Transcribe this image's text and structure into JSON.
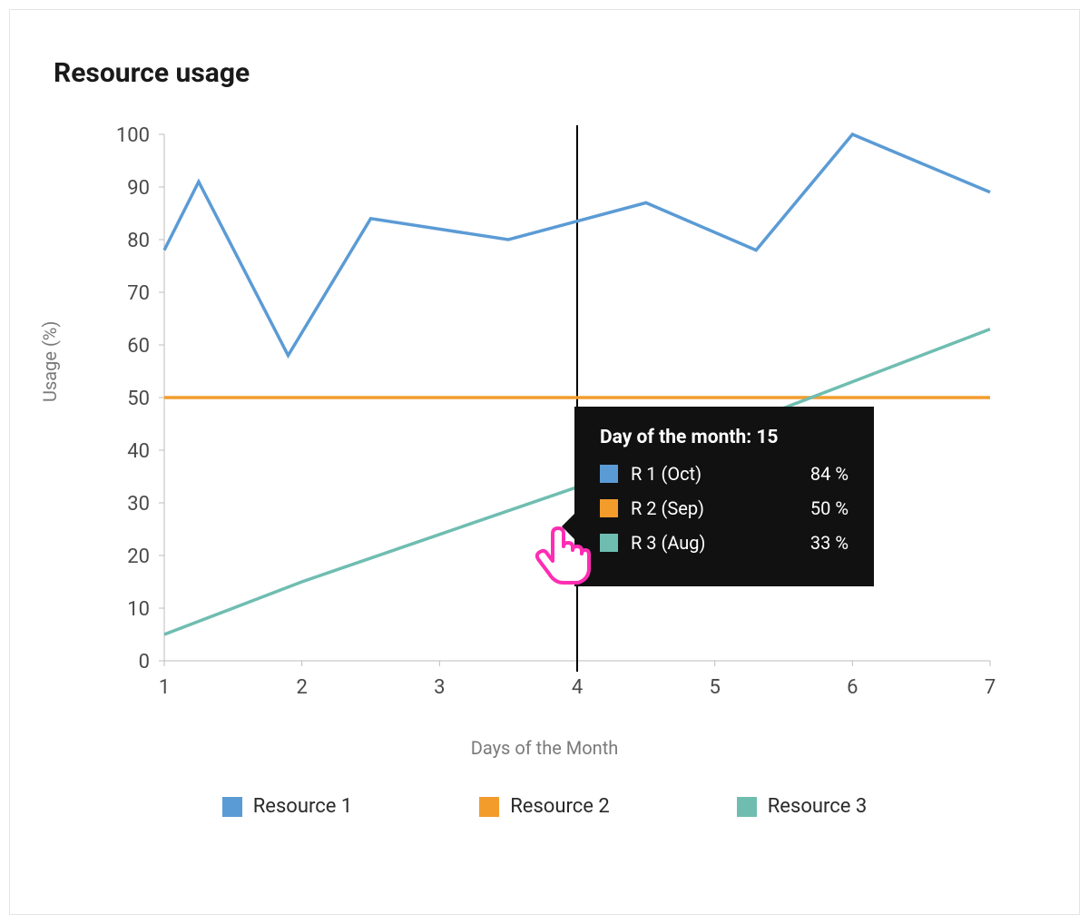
{
  "title": "Resource usage",
  "chart_data": {
    "type": "line",
    "title": "Resource usage",
    "xlabel": "Days of the Month",
    "ylabel": "Usage (%)",
    "x": [
      1,
      2,
      3,
      4,
      5,
      6,
      7
    ],
    "y_ticks": [
      0,
      10,
      20,
      30,
      40,
      50,
      60,
      70,
      80,
      90,
      100
    ],
    "xlim": [
      1,
      7
    ],
    "ylim": [
      0,
      100
    ],
    "series": [
      {
        "name": "Resource 1",
        "color": "#5b9bd5",
        "values": [
          78,
          58,
          84,
          80,
          87,
          78,
          100,
          89
        ],
        "x": [
          1,
          1.9,
          2.5,
          3.5,
          4.5,
          5.3,
          6,
          7
        ],
        "legend_short": "R 1 (Oct)"
      },
      {
        "name": "Resource 2",
        "color": "#f39c2c",
        "values": [
          50,
          50,
          50,
          50,
          50,
          50,
          50
        ],
        "x": [
          1,
          2,
          3,
          4,
          5,
          6,
          7
        ],
        "legend_short": "R 2 (Sep)"
      },
      {
        "name": "Resource 3",
        "color": "#6fbdb1",
        "values": [
          5,
          15,
          24,
          33,
          43,
          53,
          63
        ],
        "x": [
          1,
          2,
          3,
          4,
          5,
          6,
          7
        ],
        "legend_short": "R 3 (Aug)"
      }
    ],
    "extra_points_series0": {
      "x": 1.25,
      "y": 91
    },
    "hover_line_x": 4,
    "grid": false,
    "legend_position": "bottom"
  },
  "legend": {
    "items": [
      {
        "label": "Resource 1",
        "color": "#5b9bd5"
      },
      {
        "label": "Resource 2",
        "color": "#f39c2c"
      },
      {
        "label": "Resource 3",
        "color": "#6fbdb1"
      }
    ]
  },
  "tooltip": {
    "header": "Day of the month: 15",
    "rows": [
      {
        "color": "#5b9bd5",
        "label": "R 1 (Oct)",
        "value": "84 %"
      },
      {
        "color": "#f39c2c",
        "label": "R 2 (Sep)",
        "value": "50 %"
      },
      {
        "color": "#6fbdb1",
        "label": "R 3 (Aug)",
        "value": "33 %"
      }
    ]
  },
  "colors": {
    "series1": "#5b9bd5",
    "series2": "#f39c2c",
    "series3": "#6fbdb1",
    "tooltip_bg": "#111111",
    "cursor_accent": "#ff2db3"
  }
}
